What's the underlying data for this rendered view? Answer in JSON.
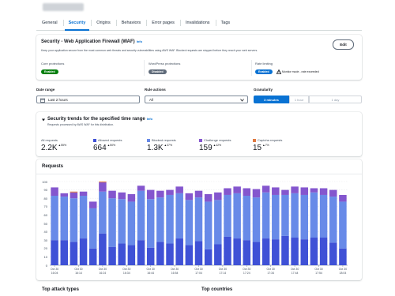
{
  "tabs": [
    "General",
    "Security",
    "Origins",
    "Behaviors",
    "Error pages",
    "Invalidations",
    "Tags"
  ],
  "active_tab": "Security",
  "waf": {
    "title": "Security - Web Application Firewall (WAF)",
    "info": "Info",
    "edit": "Edit",
    "description": "Keep your application secure from the most common web threats and security vulnerabilities using AWS WAF. Blocked requests are stopped before they reach your web servers.",
    "protections": [
      {
        "label": "Core protections",
        "status": "Enabled",
        "color": "#037f0c"
      },
      {
        "label": "WordPress protections",
        "status": "Disabled",
        "color": "#5f6b7a"
      },
      {
        "label": "Rate limiting",
        "status": "Enabled",
        "color": "#0972d3",
        "note": "Monitor mode - rate exceeded"
      }
    ]
  },
  "filters": {
    "date_range_label": "Date range",
    "date_range_value": "Last 2 hours",
    "rule_actions_label": "Rule actions",
    "rule_actions_value": "All",
    "granularity_label": "Granularity",
    "granularity_options": [
      "3 minutes",
      "1 hour",
      "1 day"
    ],
    "granularity_selected": "3 minutes"
  },
  "trends": {
    "title": "Security trends for the specified time range",
    "info": "Info",
    "subtitle": "Requests processed by AWS WAF for this distribution.",
    "metrics": [
      {
        "label": "All requests",
        "value": "2.2K",
        "change": "55%",
        "color": ""
      },
      {
        "label": "Allowed requests",
        "value": "664",
        "change": "50%",
        "color": "#3f51d6"
      },
      {
        "label": "Blocked requests",
        "value": "1.3K",
        "change": "37%",
        "color": "#688ae8"
      },
      {
        "label": "Challenge requests",
        "value": "159",
        "change": "42%",
        "color": "#8456ce"
      },
      {
        "label": "Captcha requests",
        "value": "15",
        "change": "7%",
        "color": "#e07941"
      }
    ]
  },
  "chart_data": {
    "type": "bar",
    "title": "Requests",
    "stacked": true,
    "ylim": [
      0,
      100
    ],
    "yticks": [
      0,
      10,
      20,
      30,
      40,
      50,
      60,
      70,
      80,
      90,
      100
    ],
    "x_labels": [
      {
        "date": "Oct 30",
        "time": "16:04"
      },
      {
        "date": "Oct 30",
        "time": "16:14"
      },
      {
        "date": "Oct 30",
        "time": "16:24"
      },
      {
        "date": "Oct 30",
        "time": "16:34"
      },
      {
        "date": "Oct 30",
        "time": "16:44"
      },
      {
        "date": "Oct 30",
        "time": "16:54"
      },
      {
        "date": "Oct 30",
        "time": "17:04"
      },
      {
        "date": "Oct 30",
        "time": "17:14"
      },
      {
        "date": "Oct 30",
        "time": "17:24"
      },
      {
        "date": "Oct 30",
        "time": "17:34"
      },
      {
        "date": "Oct 30",
        "time": "17:44"
      },
      {
        "date": "Oct 30",
        "time": "17:54"
      },
      {
        "date": "Oct 30",
        "time": "18:04"
      }
    ],
    "series": [
      {
        "name": "Allowed requests",
        "color": "#3f51d6",
        "values": [
          30,
          30,
          28,
          32,
          20,
          38,
          22,
          26,
          24,
          30,
          21,
          28,
          26,
          32,
          24,
          29,
          19,
          25,
          34,
          32,
          30,
          28,
          32,
          31,
          35,
          33,
          31,
          33,
          33,
          27,
          20
        ]
      },
      {
        "name": "Blocked requests",
        "color": "#688ae8",
        "values": [
          53,
          52,
          52,
          51,
          48,
          50,
          58,
          53,
          52,
          59,
          58,
          53,
          58,
          54,
          54,
          52,
          57,
          53,
          50,
          54,
          53,
          53,
          55,
          53,
          49,
          53,
          53,
          54,
          51,
          55,
          56
        ]
      },
      {
        "name": "Challenge requests",
        "color": "#8456ce",
        "values": [
          10,
          4,
          7,
          5,
          8,
          11,
          9,
          8,
          9,
          6,
          11,
          8,
          6,
          8,
          8,
          8,
          9,
          9,
          8,
          8,
          9,
          10,
          8,
          9,
          6,
          8,
          9,
          5,
          8,
          8,
          8
        ]
      },
      {
        "name": "Captcha requests",
        "color": "#e07941",
        "values": [
          0,
          0,
          1,
          0,
          0,
          1,
          0,
          0,
          0,
          0,
          0,
          0,
          0,
          0,
          0,
          0,
          0,
          0,
          0,
          0,
          0,
          0,
          0,
          0,
          0,
          0,
          0,
          0,
          0,
          0,
          0
        ]
      }
    ]
  },
  "bottom": {
    "left_title": "Top attack types",
    "right_title": "Top countries"
  }
}
